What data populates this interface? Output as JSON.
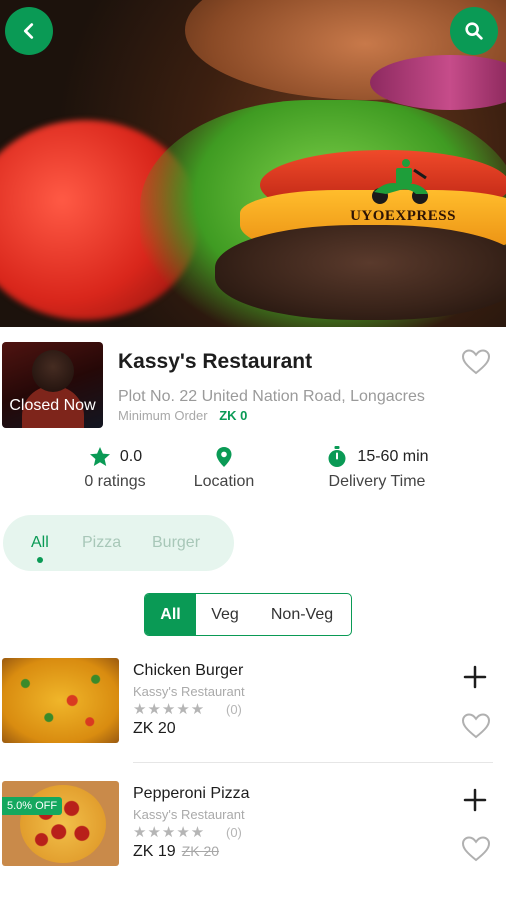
{
  "restaurant": {
    "name": "Kassy's Restaurant",
    "address": "Plot No. 22 United Nation Road, Longacres",
    "min_order_label": "Minimum Order",
    "min_order_value": "ZK 0",
    "status": "Closed Now",
    "logo_text": "UYOEXPRESS"
  },
  "stats": {
    "rating_value": "0.0",
    "rating_label": "0 ratings",
    "location_label": "Location",
    "delivery_value": "15-60 min",
    "delivery_label": "Delivery Time"
  },
  "categories": [
    "All",
    "Pizza",
    "Burger"
  ],
  "selected_category": "All",
  "veg_filter": {
    "options": [
      "All",
      "Veg",
      "Non-Veg"
    ],
    "selected": "All"
  },
  "foods": [
    {
      "name": "Chicken Burger",
      "restaurant": "Kassy's Restaurant",
      "stars": "★★★★★",
      "rating_count": "(0)",
      "price": "ZK 20",
      "old_price": "",
      "discount": ""
    },
    {
      "name": "Pepperoni Pizza",
      "restaurant": "Kassy's Restaurant",
      "stars": "★★★★★",
      "rating_count": "(0)",
      "price": "ZK 19",
      "old_price": "ZK 20",
      "discount": "5.0% OFF"
    }
  ],
  "colors": {
    "brand": "#0a9a55",
    "muted": "#9a9a9a"
  },
  "icons": {
    "back": "back-arrow-icon",
    "search": "search-icon",
    "favorite": "heart-outline-icon",
    "star": "star-icon",
    "location": "location-pin-icon",
    "timer": "stopwatch-icon",
    "add": "plus-icon"
  }
}
